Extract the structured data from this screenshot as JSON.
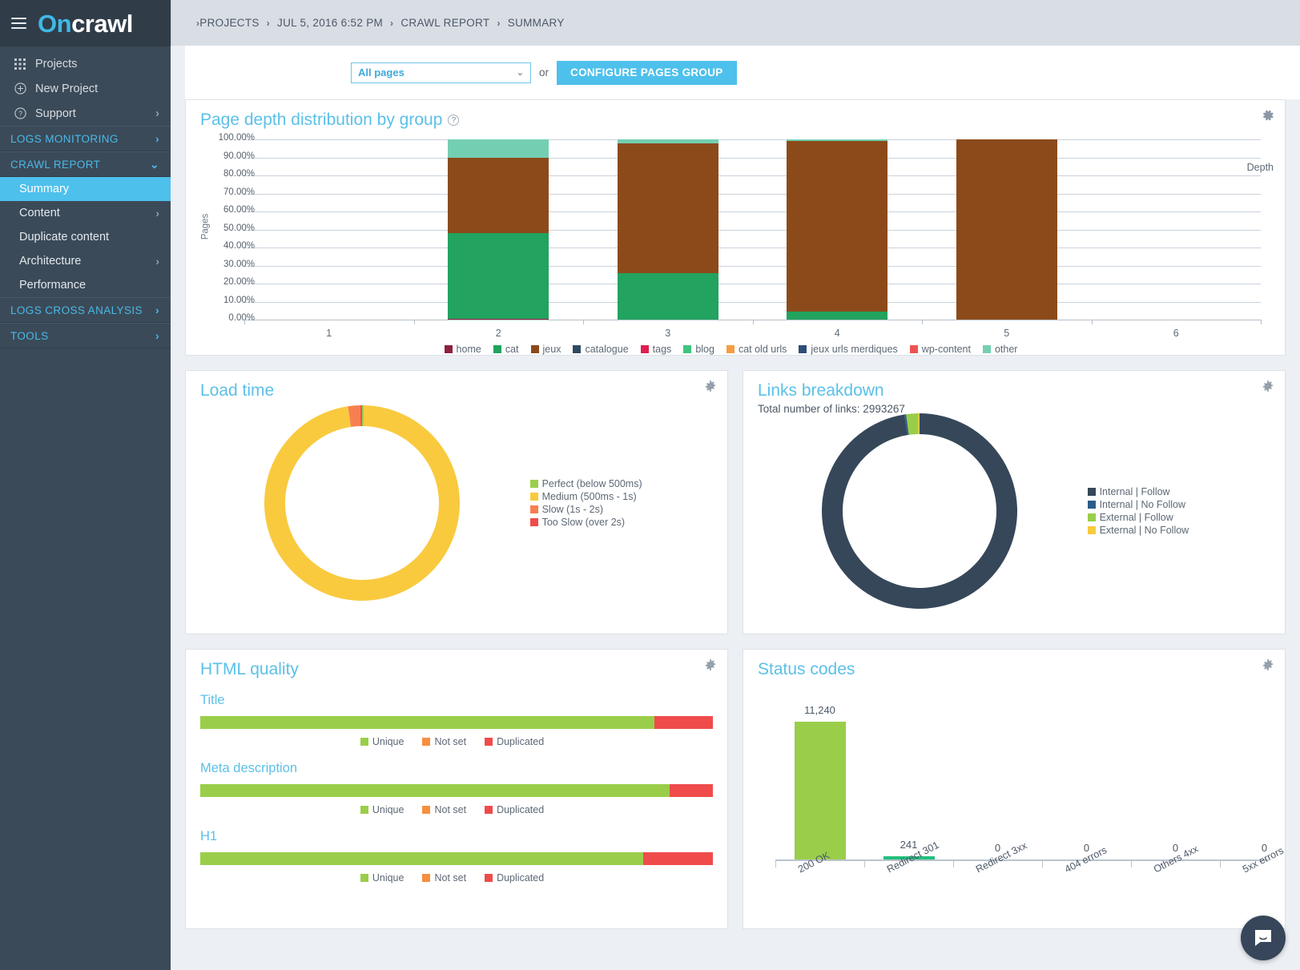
{
  "brand": {
    "name_on": "On",
    "name_crawl": "crawl",
    "menu_icon": "hamburger-icon"
  },
  "sidebar": {
    "top_items": [
      {
        "label": "Projects",
        "icon": "grid-icon",
        "chevron": ""
      },
      {
        "label": "New Project",
        "icon": "plus-circle-icon",
        "chevron": ""
      },
      {
        "label": "Support",
        "icon": "question-circle-icon",
        "chevron": "›"
      }
    ],
    "sections": [
      {
        "label": "LOGS MONITORING",
        "chevron": "›",
        "expanded": false,
        "children": []
      },
      {
        "label": "CRAWL REPORT",
        "chevron": "⌄",
        "expanded": true,
        "children": [
          {
            "label": "Summary",
            "active": true,
            "chevron": ""
          },
          {
            "label": "Content",
            "active": false,
            "chevron": "›"
          },
          {
            "label": "Duplicate content",
            "active": false,
            "chevron": ""
          },
          {
            "label": "Architecture",
            "active": false,
            "chevron": "›"
          },
          {
            "label": "Performance",
            "active": false,
            "chevron": ""
          }
        ]
      },
      {
        "label": "LOGS CROSS ANALYSIS",
        "chevron": "›",
        "expanded": false,
        "children": []
      },
      {
        "label": "TOOLS",
        "chevron": "›",
        "expanded": false,
        "children": []
      }
    ]
  },
  "breadcrumb": {
    "lead_sep": "›",
    "items": [
      "PROJECTS",
      "JUL 5, 2016 6:52 PM",
      "CRAWL REPORT",
      "SUMMARY"
    ],
    "separator": "›"
  },
  "filterbar": {
    "select_value": "All pages",
    "select_caret": "⌄",
    "or_label": "or",
    "configure_button": "CONFIGURE PAGES GROUP"
  },
  "colors": {
    "accent": "#4ec0ec",
    "title": "#5bc0e8",
    "sidebar_bg": "#3b4a58",
    "sidebar_active": "#4ec0ec",
    "crumb_bg": "#d9dee5"
  },
  "cards": {
    "depth": {
      "title": "Page depth distribution by group",
      "help": "?",
      "gear": "gear-icon"
    },
    "load_time": {
      "title": "Load time",
      "gear": "gear-icon"
    },
    "links": {
      "title": "Links breakdown",
      "subtitle": "Total number of links: 2993267",
      "gear": "gear-icon"
    },
    "html_quality": {
      "title": "HTML quality",
      "gear": "gear-icon"
    },
    "status_codes": {
      "title": "Status codes",
      "gear": "gear-icon"
    }
  },
  "chart_data": [
    {
      "id": "page-depth-distribution",
      "type": "bar",
      "stacked": true,
      "stack_mode": "percent",
      "title": "Page depth distribution by group",
      "xlabel": "Depth",
      "ylabel": "Pages",
      "categories": [
        "1",
        "2",
        "3",
        "4",
        "5",
        "6"
      ],
      "ylim": [
        0,
        100
      ],
      "ytick_labels": [
        "0.00%",
        "10.00%",
        "20.00%",
        "30.00%",
        "40.00%",
        "50.00%",
        "60.00%",
        "70.00%",
        "80.00%",
        "90.00%",
        "100.00%"
      ],
      "grid": true,
      "legend_position": "bottom",
      "series": [
        {
          "name": "home",
          "color": "#8e2140",
          "values": [
            0,
            0.6,
            0,
            0,
            0,
            0
          ]
        },
        {
          "name": "cat",
          "color": "#22a35f",
          "values": [
            0,
            47.4,
            26.0,
            4.6,
            0,
            0
          ]
        },
        {
          "name": "jeux",
          "color": "#8c4a1a",
          "values": [
            0,
            42.0,
            71.8,
            94.6,
            100,
            0
          ]
        },
        {
          "name": "catalogue",
          "color": "#2f4a63",
          "values": [
            0,
            0,
            0,
            0,
            0,
            0
          ]
        },
        {
          "name": "tags",
          "color": "#e01e50",
          "values": [
            0,
            0,
            0,
            0,
            0,
            0
          ]
        },
        {
          "name": "blog",
          "color": "#3fc47f",
          "values": [
            0,
            0,
            0,
            0,
            0,
            0
          ]
        },
        {
          "name": "cat old urls",
          "color": "#f79c42",
          "values": [
            0,
            0,
            0,
            0,
            0,
            0
          ]
        },
        {
          "name": "jeux urls merdiques",
          "color": "#2e4d7a",
          "values": [
            0,
            0,
            0,
            0,
            0,
            0
          ]
        },
        {
          "name": "wp-content",
          "color": "#ef5350",
          "values": [
            0,
            0,
            0,
            0,
            0,
            0
          ]
        },
        {
          "name": "other",
          "color": "#74cfb2",
          "values": [
            0,
            10.0,
            2.2,
            0.8,
            0,
            0
          ]
        }
      ]
    },
    {
      "id": "load-time",
      "type": "pie",
      "donut": true,
      "title": "Load time",
      "legend_position": "right",
      "labels": [
        "Perfect (below 500ms)",
        "Medium (500ms - 1s)",
        "Slow (1s - 2s)",
        "Too Slow (over 2s)"
      ],
      "colors": [
        "#9ace4a",
        "#f9ca3e",
        "#f87f50",
        "#f04b4b"
      ],
      "values": [
        0.3,
        97.4,
        2.0,
        0.3
      ]
    },
    {
      "id": "links-breakdown",
      "type": "pie",
      "donut": true,
      "title": "Links breakdown",
      "subtitle": "Total number of links: 2993267",
      "legend_position": "right",
      "labels": [
        "Internal | Follow",
        "Internal | No Follow",
        "External | Follow",
        "External | No Follow"
      ],
      "colors": [
        "#36475a",
        "#2b5d8b",
        "#9ace4a",
        "#f9ca3e"
      ],
      "values": [
        97.5,
        0.3,
        2.0,
        0.2
      ]
    },
    {
      "id": "html-quality",
      "type": "bar",
      "stacked": true,
      "stack_mode": "percent",
      "title": "HTML quality",
      "legend": [
        "Unique",
        "Not set",
        "Duplicated"
      ],
      "legend_colors": [
        "#9ace4a",
        "#f78f3f",
        "#f04b4b"
      ],
      "groups": [
        {
          "label": "Title",
          "values": [
            88.6,
            0.0,
            11.4
          ]
        },
        {
          "label": "Meta description",
          "values": [
            91.5,
            0.0,
            8.5
          ]
        },
        {
          "label": "H1",
          "values": [
            86.4,
            0.0,
            13.6
          ]
        }
      ]
    },
    {
      "id": "status-codes",
      "type": "bar",
      "title": "Status codes",
      "categories": [
        "200 OK",
        "Redirect 301",
        "Redirect 3xx",
        "404 errors",
        "Others 4xx",
        "5xx errors"
      ],
      "value_labels": [
        "11,240",
        "241",
        "0",
        "0",
        "0",
        "0"
      ],
      "values": [
        11240,
        241,
        0,
        0,
        0,
        0
      ],
      "colors": [
        "#9ace4a",
        "#22c07d",
        "#2bb5a0",
        "#f9ca3e",
        "#f78f3f",
        "#f04b4b"
      ],
      "ylim": [
        0,
        12400
      ]
    }
  ],
  "chat": {
    "icon": "chat-bubble-icon"
  }
}
